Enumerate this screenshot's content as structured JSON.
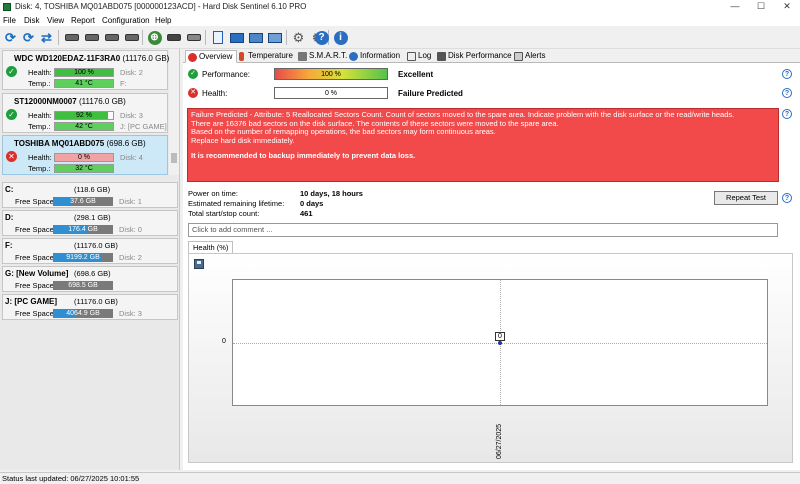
{
  "window": {
    "title": "Disk: 4, TOSHIBA MQ01ABD075 [000000123ACD]  -  Hard Disk Sentinel 6.10 PRO",
    "minimize": "—",
    "maximize": "☐",
    "close": "✕"
  },
  "menu": [
    "File",
    "Disk",
    "View",
    "Report",
    "Configuration",
    "Help"
  ],
  "disks": [
    {
      "name": "WDC WD120EDAZ-11F3RA0",
      "size": "(11176.0 GB)",
      "health_label": "Health:",
      "health": "100 %",
      "health_pct": 100,
      "temp_label": "Temp.:",
      "temp": "41 °C",
      "extra1": "Disk: 2",
      "extra2": "F:",
      "status": "ok"
    },
    {
      "name": "ST12000NM0007",
      "size": "(11176.0 GB)",
      "health_label": "Health:",
      "health": "92 %",
      "health_pct": 92,
      "temp_label": "Temp.:",
      "temp": "42 °C",
      "extra1": "Disk: 3",
      "extra2": "J: [PC GAME]",
      "status": "ok"
    },
    {
      "name": "TOSHIBA MQ01ABD075",
      "size": "(698.6 GB)",
      "health_label": "Health:",
      "health": "0 %",
      "health_pct": 0,
      "temp_label": "Temp.:",
      "temp": "32 °C",
      "extra1": "Disk: 4",
      "extra2": "",
      "status": "bad"
    }
  ],
  "volumes": [
    {
      "name": "C:",
      "size": "(118.6 GB)",
      "free_label": "Free Space",
      "free": "37.6 GB",
      "free_pct": 32,
      "disk": "Disk: 1"
    },
    {
      "name": "D:",
      "size": "(298.1 GB)",
      "free_label": "Free Space",
      "free": "176.4 GB",
      "free_pct": 59,
      "disk": "Disk: 0"
    },
    {
      "name": "F:",
      "size": "(11176.0 GB)",
      "free_label": "Free Space",
      "free": "9199.2 GB",
      "free_pct": 82,
      "disk": "Disk: 2"
    },
    {
      "name": "G: [New Volume]",
      "size": "(698.6 GB)",
      "free_label": "Free Space",
      "free": "698.5 GB",
      "free_pct": 100,
      "disk": ""
    },
    {
      "name": "J: [PC GAME]",
      "size": "(11176.0 GB)",
      "free_label": "Free Space",
      "free": "4064.9 GB",
      "free_pct": 36,
      "disk": "Disk: 3"
    }
  ],
  "tabs": [
    "Overview",
    "Temperature",
    "S.M.A.R.T.",
    "Information",
    "Log",
    "Disk Performance",
    "Alerts"
  ],
  "overview": {
    "performance_label": "Performance:",
    "performance_value": "100 %",
    "performance_pct": 100,
    "performance_text": "Excellent",
    "health_label": "Health:",
    "health_value": "0 %",
    "health_pct": 0,
    "health_text": "Failure Predicted",
    "alert_lines": [
      "Failure Predicted - Attribute: 5 Reallocated Sectors Count. Count of sectors moved to the spare area. Indicate problem with the disk surface or the read/write heads.",
      "There are 16376 bad sectors on the disk surface. The contents of these sectors were moved to the spare area.",
      "Based on the number of remapping operations, the bad sectors may form continuous areas.",
      "Replace hard disk immediately."
    ],
    "alert_recommendation": "It is recommended to backup immediately to prevent data loss.",
    "power_on_label": "Power on time:",
    "power_on_value": "10 days, 18 hours",
    "lifetime_label": "Estimated remaining lifetime:",
    "lifetime_value": "0 days",
    "startstop_label": "Total start/stop count:",
    "startstop_value": "461",
    "repeat_test": "Repeat Test",
    "comment_placeholder": "Click to add comment ...",
    "chart_tab": "Health (%)",
    "help": "?"
  },
  "chart_data": {
    "type": "line",
    "x": [
      "06/27/2025"
    ],
    "series": [
      {
        "values": [
          0
        ]
      }
    ],
    "point_labels": [
      "0"
    ],
    "ytick": "0",
    "grid": true
  },
  "statusbar": "Status last updated: 06/27/2025 10:01:55"
}
